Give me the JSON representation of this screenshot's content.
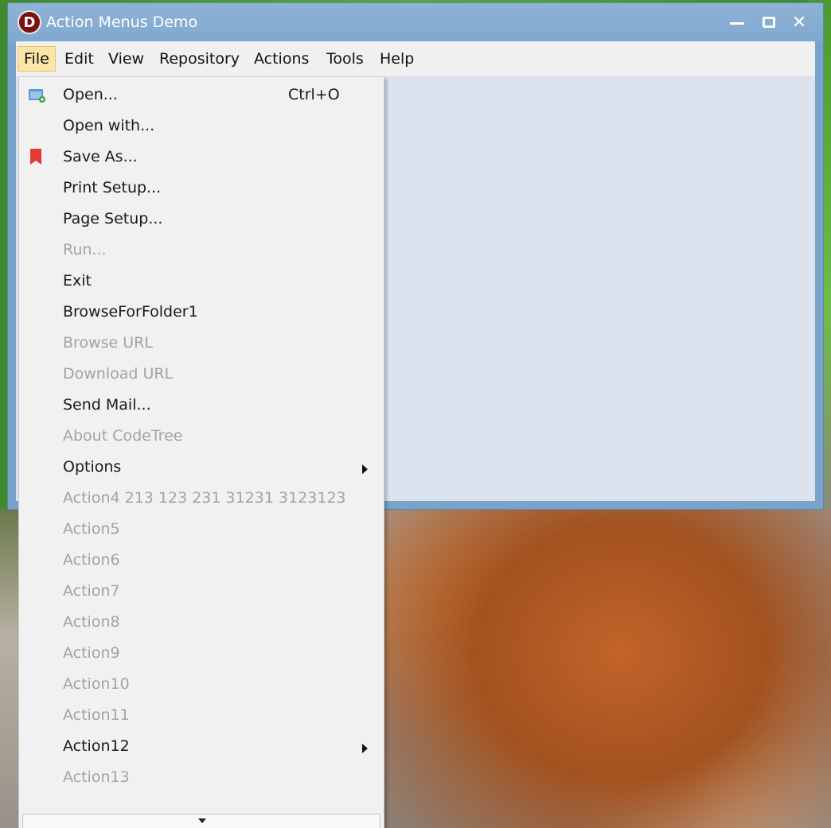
{
  "window": {
    "title": "Action Menus Demo",
    "logo_letter": "D"
  },
  "menubar": [
    {
      "label": "File",
      "active": true
    },
    {
      "label": "Edit"
    },
    {
      "label": "View"
    },
    {
      "label": "Repository"
    },
    {
      "label": "Actions"
    },
    {
      "label": "Tools"
    },
    {
      "label": "Help"
    }
  ],
  "file_menu": {
    "items": [
      {
        "label": "Open...",
        "shortcut": "Ctrl+O",
        "icon": "open-file-icon",
        "enabled": true
      },
      {
        "label": "Open with...",
        "enabled": true
      },
      {
        "label": "Save As...",
        "icon": "bookmark-save-icon",
        "enabled": true
      },
      {
        "label": "Print Setup...",
        "enabled": true
      },
      {
        "label": "Page Setup...",
        "enabled": true
      },
      {
        "label": "Run...",
        "enabled": false
      },
      {
        "label": "Exit",
        "enabled": true
      },
      {
        "label": "BrowseForFolder1",
        "enabled": true
      },
      {
        "label": "Browse URL",
        "enabled": false
      },
      {
        "label": "Download URL",
        "enabled": false
      },
      {
        "label": "Send Mail...",
        "enabled": true
      },
      {
        "label": "About CodeTree",
        "enabled": false
      },
      {
        "label": "Options",
        "enabled": true,
        "submenu": true
      },
      {
        "label": "Action4 213 123 231 31231 3123123",
        "enabled": false
      },
      {
        "label": "Action5",
        "enabled": false
      },
      {
        "label": "Action6",
        "enabled": false
      },
      {
        "label": "Action7",
        "enabled": false
      },
      {
        "label": "Action8",
        "enabled": false
      },
      {
        "label": "Action9",
        "enabled": false
      },
      {
        "label": "Action10",
        "enabled": false
      },
      {
        "label": "Action11",
        "enabled": false
      },
      {
        "label": "Action12",
        "enabled": true,
        "submenu": true
      },
      {
        "label": "Action13",
        "enabled": false
      }
    ]
  },
  "colors": {
    "titlebar": "#80a8cf",
    "menu_active": "#fbe5a8",
    "disabled_text": "#a3a3a3",
    "save_icon": "#e53935",
    "open_icon": "#5b9bd5"
  }
}
